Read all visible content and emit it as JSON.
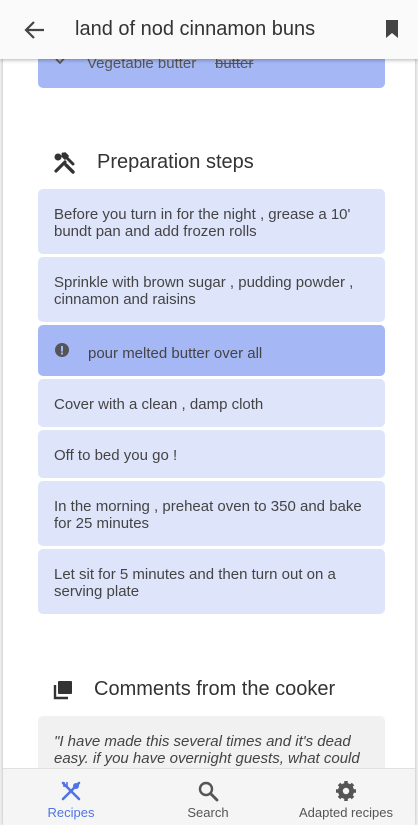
{
  "appbar": {
    "title": "land of nod cinnamon buns",
    "back_icon": "arrow-left-icon",
    "bookmark_icon": "bookmark-icon"
  },
  "previous_ingredient": {
    "name": "Vegetable butter",
    "original": "butter",
    "icon": "check-icon"
  },
  "preparation": {
    "heading": "Preparation steps",
    "icon": "tools-icon",
    "steps": [
      {
        "text": "Before you turn in for the night , grease a 10' bundt pan and add frozen rolls",
        "highlight": false
      },
      {
        "text": "Sprinkle with brown sugar , pudding powder , cinnamon and raisins",
        "highlight": false
      },
      {
        "text": "pour melted butter over all",
        "highlight": true,
        "icon": "alert-icon"
      },
      {
        "text": "Cover with a clean , damp cloth",
        "highlight": false
      },
      {
        "text": "Off to bed you go !",
        "highlight": false
      },
      {
        "text": "In the morning , preheat oven to 350 and bake for 25 minutes",
        "highlight": false
      },
      {
        "text": "Let sit for 5 minutes and then turn out on a serving plate",
        "highlight": false
      }
    ]
  },
  "comments": {
    "heading": "Comments from the cooker",
    "icon": "comments-icon",
    "text": "\"I have made this several times and it's dead easy. if you have overnight guests, what could be nicer to find awaking than cinnamon buns."
  },
  "bottom_nav": {
    "items": [
      {
        "label": "Recipes",
        "icon": "utensils-icon",
        "active": true
      },
      {
        "label": "Search",
        "icon": "search-icon",
        "active": false
      },
      {
        "label": "Adapted recipes",
        "icon": "gear-icon",
        "active": false
      }
    ]
  },
  "colors": {
    "accent": "#4f74e6",
    "step_bg": "#dee5fb",
    "highlight_bg": "#a5b8f5"
  }
}
